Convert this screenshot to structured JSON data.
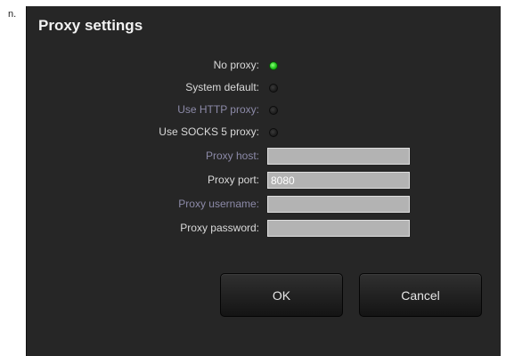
{
  "corner_mark": "n.",
  "dialog": {
    "title": "Proxy settings",
    "proxy_options": [
      {
        "label": "No proxy:",
        "selected": true
      },
      {
        "label": "System default:",
        "selected": false
      },
      {
        "label": "Use HTTP proxy:",
        "selected": false
      },
      {
        "label": "Use SOCKS 5 proxy:",
        "selected": false
      }
    ],
    "fields": {
      "host": {
        "label": "Proxy host:",
        "value": ""
      },
      "port": {
        "label": "Proxy port:",
        "value": "8080"
      },
      "username": {
        "label": "Proxy username:",
        "value": ""
      },
      "password": {
        "label": "Proxy password:",
        "value": ""
      }
    },
    "buttons": {
      "ok": "OK",
      "cancel": "Cancel"
    }
  },
  "colors": {
    "dialog_background": "#262626",
    "selected_radio": "#1fc41a",
    "field_background": "#b3b3b3"
  }
}
